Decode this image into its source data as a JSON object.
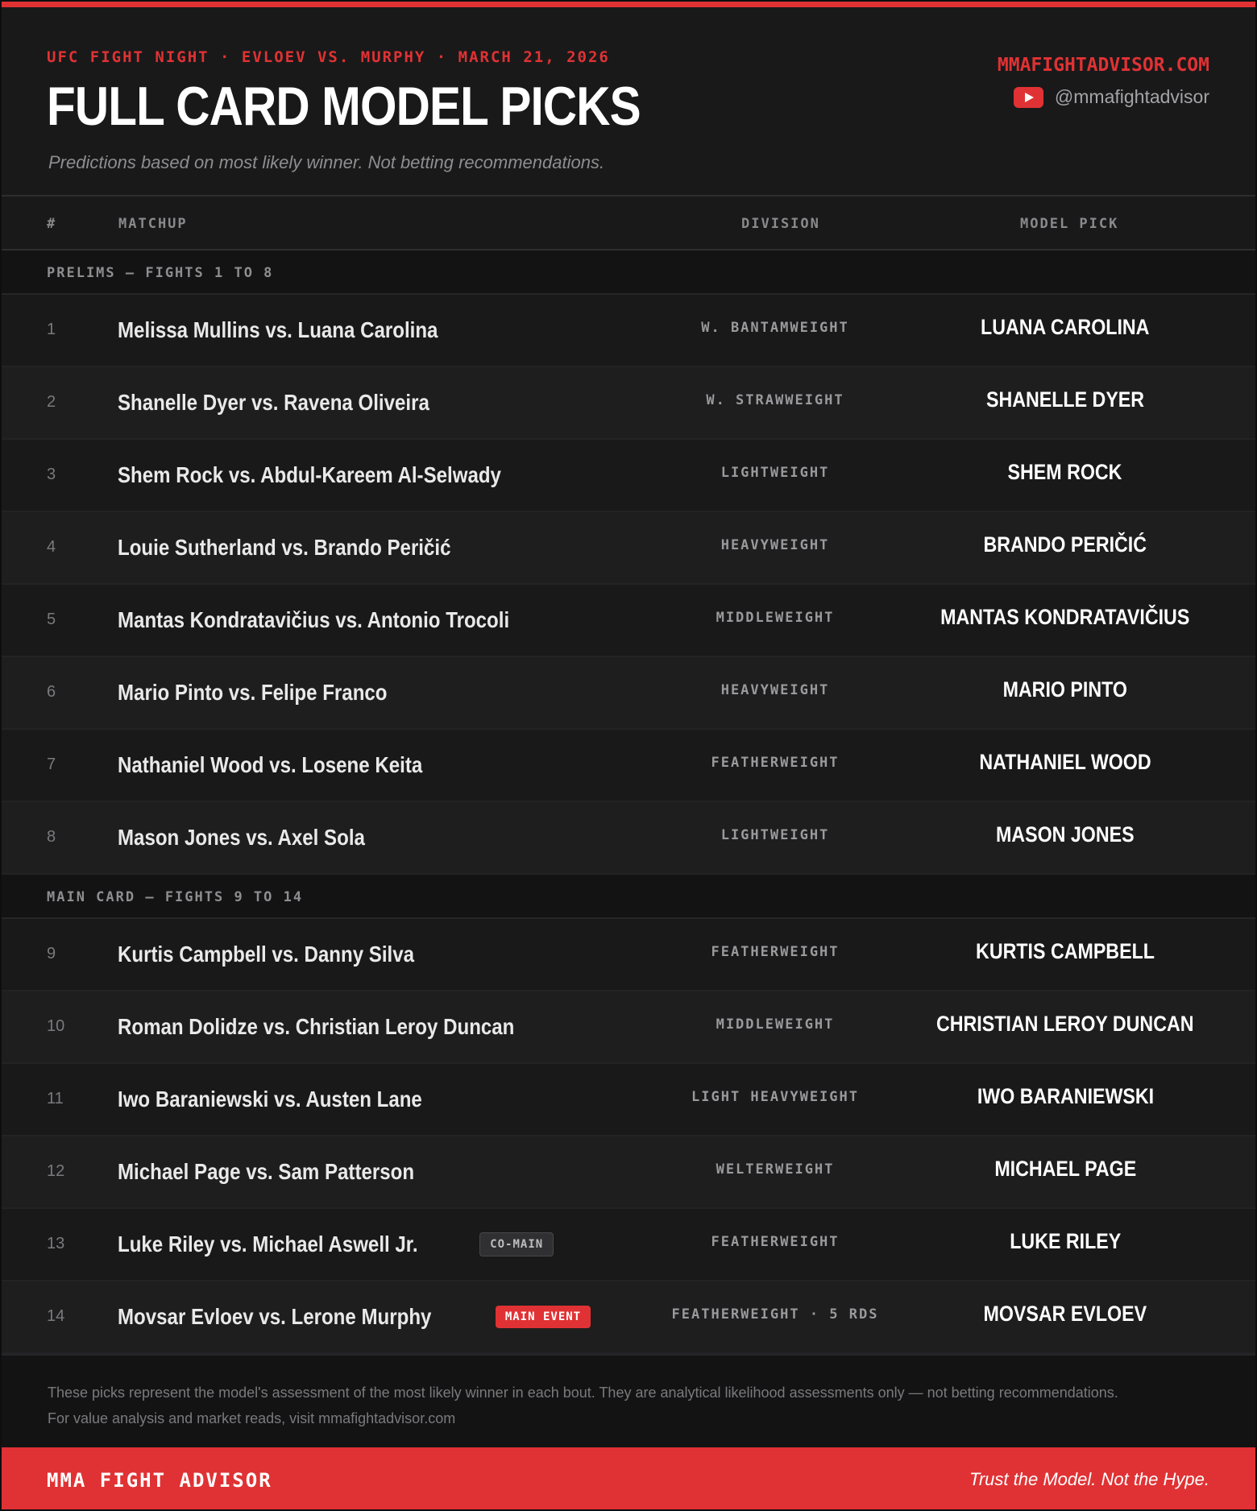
{
  "header": {
    "eyebrow": "UFC FIGHT NIGHT · EVLOEV VS. MURPHY · MARCH 21, 2026",
    "title": "FULL CARD MODEL PICKS",
    "subtitle": "Predictions based on most likely winner. Not betting recommendations.",
    "brand_url": "MMAFIGHTADVISOR.COM",
    "youtube_handle": "@mmafightadvisor",
    "youtube_icon": "youtube-play-icon"
  },
  "columns": {
    "num": "#",
    "matchup": "MATCHUP",
    "division": "DIVISION",
    "pick": "MODEL PICK"
  },
  "sections": [
    {
      "label": "PRELIMS — FIGHTS 1 TO 8",
      "fights": [
        {
          "num": "1",
          "matchup": "Melissa Mullins vs. Luana Carolina",
          "division": "W. BANTAMWEIGHT",
          "pick": "LUANA CAROLINA"
        },
        {
          "num": "2",
          "matchup": "Shanelle Dyer vs. Ravena Oliveira",
          "division": "W. STRAWWEIGHT",
          "pick": "SHANELLE DYER"
        },
        {
          "num": "3",
          "matchup": "Shem Rock vs. Abdul-Kareem Al-Selwady",
          "division": "LIGHTWEIGHT",
          "pick": "SHEM ROCK"
        },
        {
          "num": "4",
          "matchup": "Louie Sutherland vs. Brando Peričić",
          "division": "HEAVYWEIGHT",
          "pick": "BRANDO PERIČIĆ"
        },
        {
          "num": "5",
          "matchup": "Mantas Kondratavičius vs. Antonio Trocoli",
          "division": "MIDDLEWEIGHT",
          "pick": "MANTAS KONDRATAVIČIUS"
        },
        {
          "num": "6",
          "matchup": "Mario Pinto vs. Felipe Franco",
          "division": "HEAVYWEIGHT",
          "pick": "MARIO PINTO"
        },
        {
          "num": "7",
          "matchup": "Nathaniel Wood vs. Losene Keita",
          "division": "FEATHERWEIGHT",
          "pick": "NATHANIEL WOOD"
        },
        {
          "num": "8",
          "matchup": "Mason Jones vs. Axel Sola",
          "division": "LIGHTWEIGHT",
          "pick": "MASON JONES"
        }
      ]
    },
    {
      "label": "MAIN CARD — FIGHTS 9 TO 14",
      "fights": [
        {
          "num": "9",
          "matchup": "Kurtis Campbell vs. Danny Silva",
          "division": "FEATHERWEIGHT",
          "pick": "KURTIS CAMPBELL"
        },
        {
          "num": "10",
          "matchup": "Roman Dolidze vs. Christian Leroy Duncan",
          "division": "MIDDLEWEIGHT",
          "pick": "CHRISTIAN LEROY DUNCAN"
        },
        {
          "num": "11",
          "matchup": "Iwo Baraniewski vs. Austen Lane",
          "division": "LIGHT HEAVYWEIGHT",
          "pick": "IWO BARANIEWSKI"
        },
        {
          "num": "12",
          "matchup": "Michael Page vs. Sam Patterson",
          "division": "WELTERWEIGHT",
          "pick": "MICHAEL PAGE"
        },
        {
          "num": "13",
          "matchup": "Luke Riley vs. Michael Aswell Jr.",
          "badge": "CO-MAIN",
          "badge_style": "comain",
          "division": "FEATHERWEIGHT",
          "pick": "LUKE RILEY"
        },
        {
          "num": "14",
          "matchup": "Movsar Evloev vs. Lerone Murphy",
          "badge": "MAIN EVENT",
          "badge_style": "mainev",
          "division": "FEATHERWEIGHT · 5 RDS",
          "pick": "MOVSAR EVLOEV"
        }
      ]
    }
  ],
  "footnote": {
    "line1": "These picks represent the model's assessment of the most likely winner in each bout. They are analytical likelihood assessments only — not betting recommendations.",
    "line2": "For value analysis and market reads, visit mmafightadvisor.com"
  },
  "footer": {
    "brand": "MMA FIGHT ADVISOR",
    "tagline": "Trust the Model. Not the Hype."
  },
  "colors": {
    "accent": "#e03234",
    "background": "#19191a",
    "text": "#ffffff"
  }
}
